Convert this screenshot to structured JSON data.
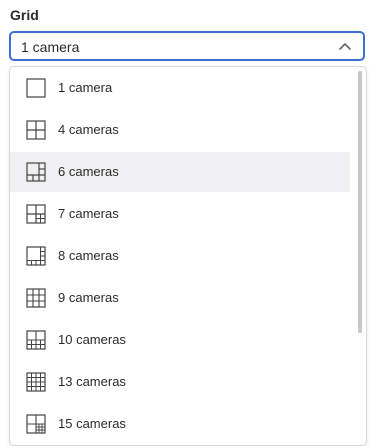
{
  "field": {
    "label": "Grid",
    "selected": "1 camera"
  },
  "options": [
    {
      "label": "1 camera",
      "icon": "grid-1-icon",
      "highlighted": false
    },
    {
      "label": "4 cameras",
      "icon": "grid-4-icon",
      "highlighted": false
    },
    {
      "label": "6 cameras",
      "icon": "grid-6-icon",
      "highlighted": true
    },
    {
      "label": "7 cameras",
      "icon": "grid-7-icon",
      "highlighted": false
    },
    {
      "label": "8 cameras",
      "icon": "grid-8-icon",
      "highlighted": false
    },
    {
      "label": "9 cameras",
      "icon": "grid-9-icon",
      "highlighted": false
    },
    {
      "label": "10 cameras",
      "icon": "grid-10-icon",
      "highlighted": false
    },
    {
      "label": "13 cameras",
      "icon": "grid-13-icon",
      "highlighted": false
    },
    {
      "label": "15 cameras",
      "icon": "grid-15-icon",
      "highlighted": false
    }
  ],
  "colors": {
    "accent": "#3b6fd1",
    "highlight": "#f0f0f2",
    "scrollbar": "#c7c7c7"
  }
}
